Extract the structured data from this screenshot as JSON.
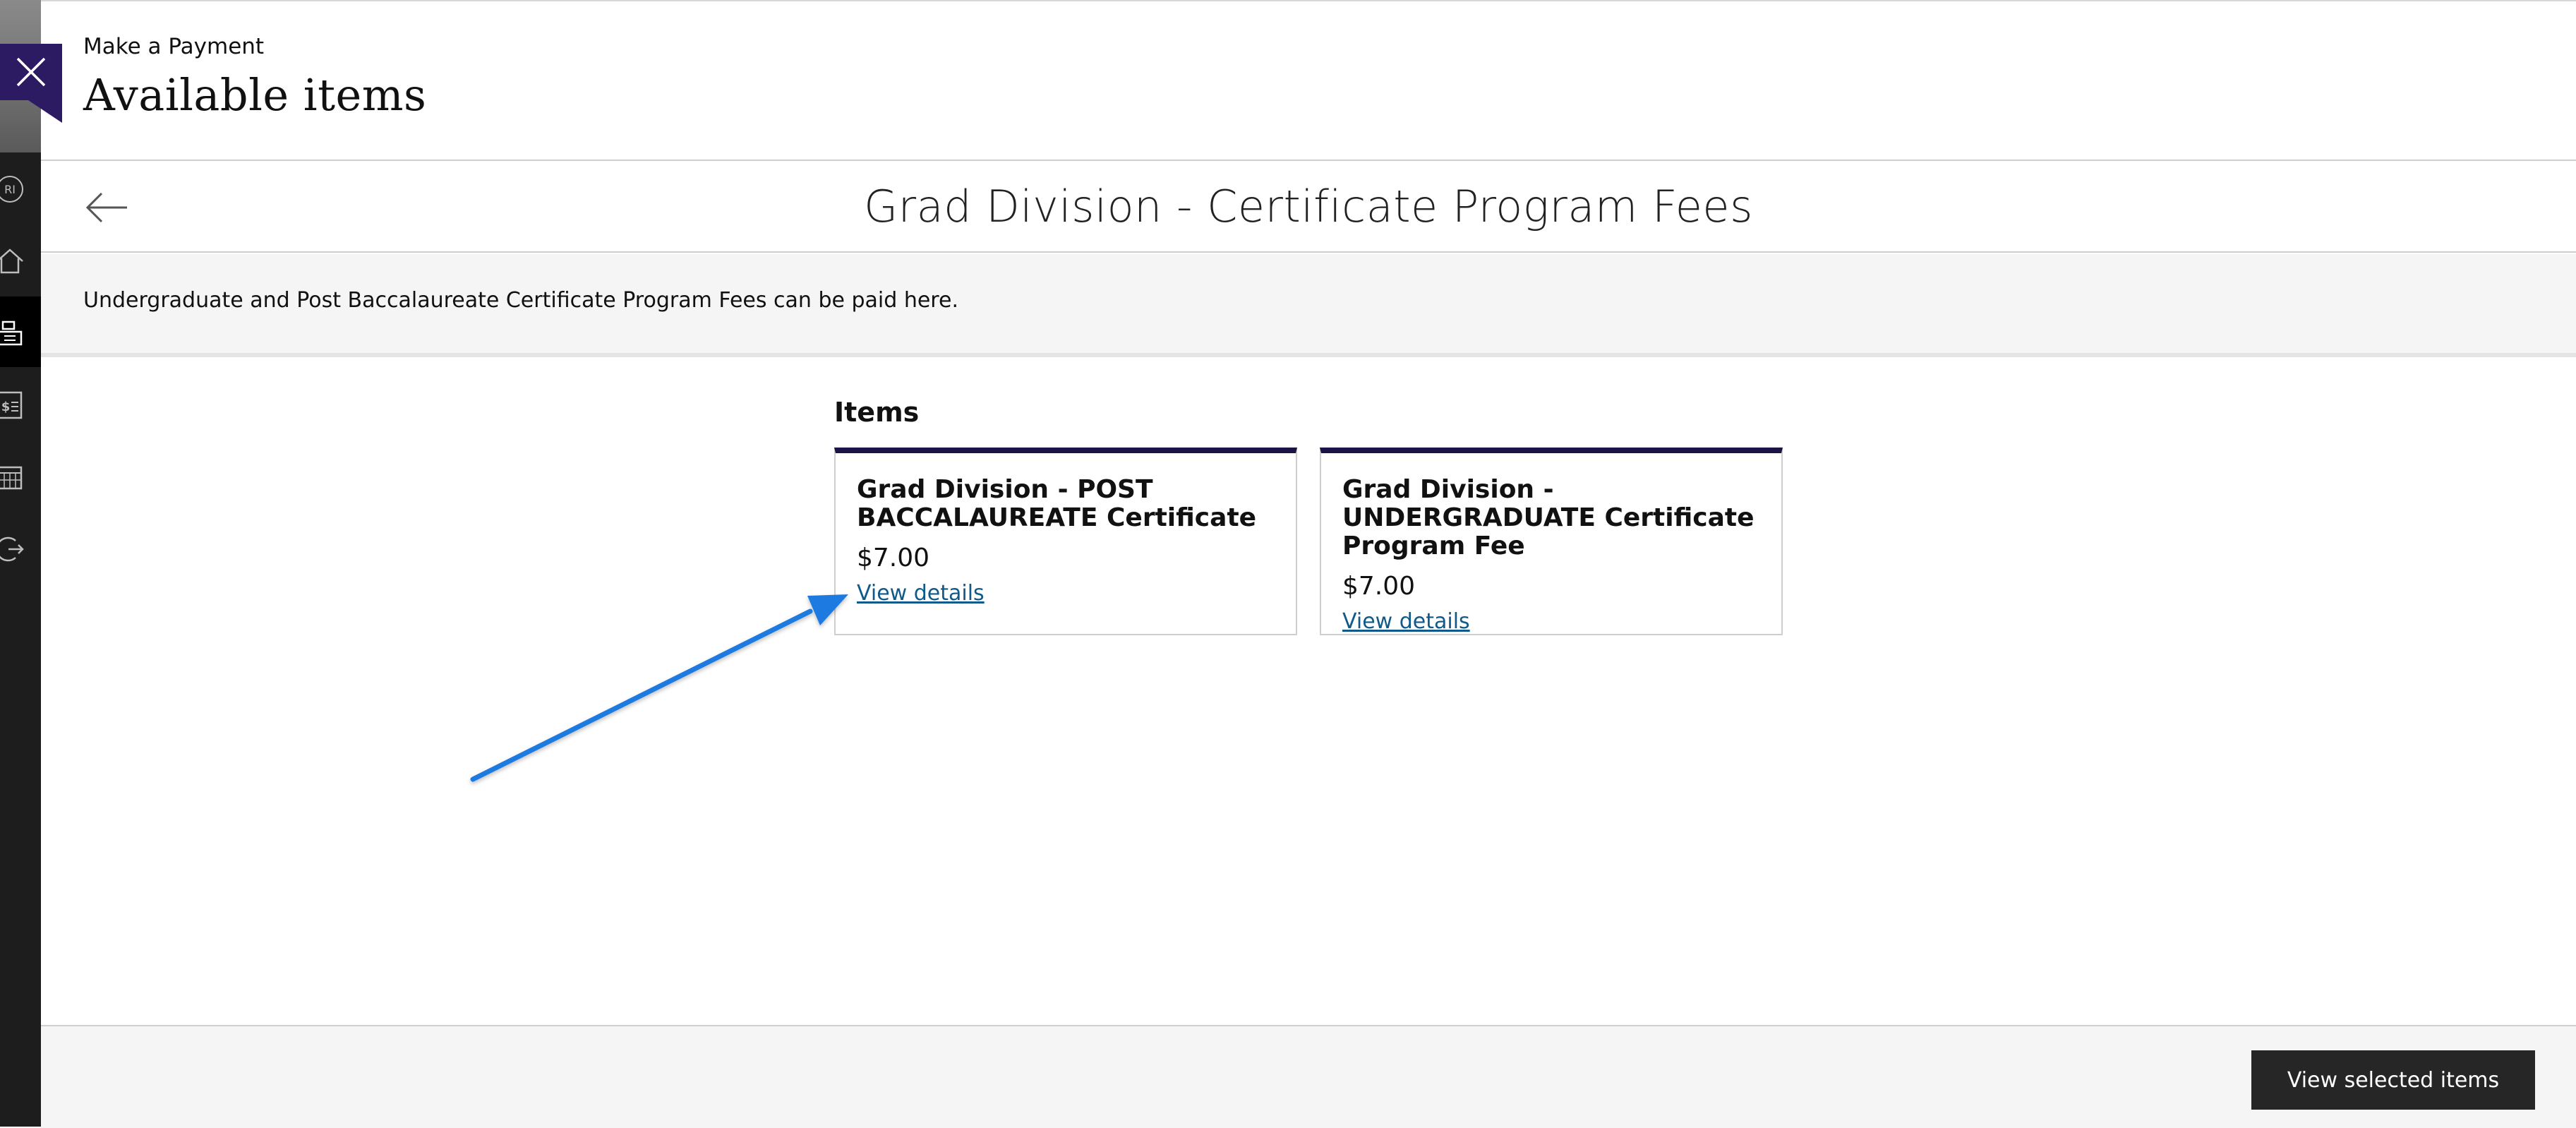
{
  "header": {
    "breadcrumb": "Make a Payment",
    "title": "Available items"
  },
  "close_button": {
    "icon": "close-icon"
  },
  "sidebar": {
    "icons": [
      "avatar-initials-icon",
      "home-icon",
      "cash-register-icon",
      "bill-icon",
      "calendar-icon",
      "logout-icon"
    ],
    "avatar_initials": "RI"
  },
  "section": {
    "back_icon": "arrow-left-icon",
    "title": "Grad Division - Certificate Program Fees",
    "description": "Undergraduate and Post Baccalaureate Certificate Program Fees can be paid here."
  },
  "items": {
    "heading": "Items",
    "cards": [
      {
        "title": "Grad Division - POST BACCALAUREATE Certificate",
        "price": "$7.00",
        "link": "View details"
      },
      {
        "title": "Grad Division - UNDERGRADUATE Certificate Program Fee",
        "price": "$7.00",
        "link": "View details"
      }
    ]
  },
  "footer": {
    "button_label": "View selected items"
  },
  "colors": {
    "accent": "#2c1a63",
    "card_top_border": "#1b1346",
    "link": "#0f5a8a",
    "annotation_arrow": "#1f7ae0",
    "footer_button": "#262626"
  }
}
